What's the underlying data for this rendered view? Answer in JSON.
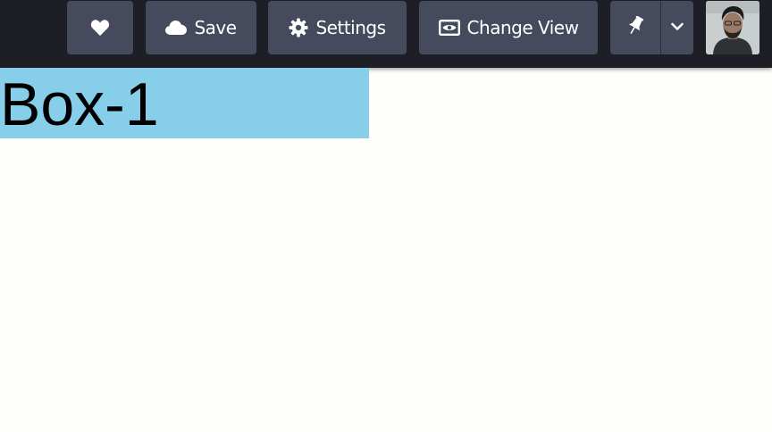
{
  "toolbar": {
    "favorite": {
      "icon": "heart-icon"
    },
    "save": {
      "label": "Save",
      "icon": "cloud-icon"
    },
    "settings": {
      "label": "Settings",
      "icon": "gear-icon"
    },
    "change_view": {
      "label": "Change View",
      "icon": "eye-window-icon"
    },
    "pin_split": {
      "icon": "pin-icon",
      "menu_icon": "chevron-down-icon"
    },
    "avatar": {
      "icon": "user-avatar"
    }
  },
  "content": {
    "box1_label": "Box-1"
  },
  "colors": {
    "topbar": "#1e1f26",
    "button": "#454a5d",
    "box1": "#87ceeb",
    "page": "#fefefc"
  }
}
